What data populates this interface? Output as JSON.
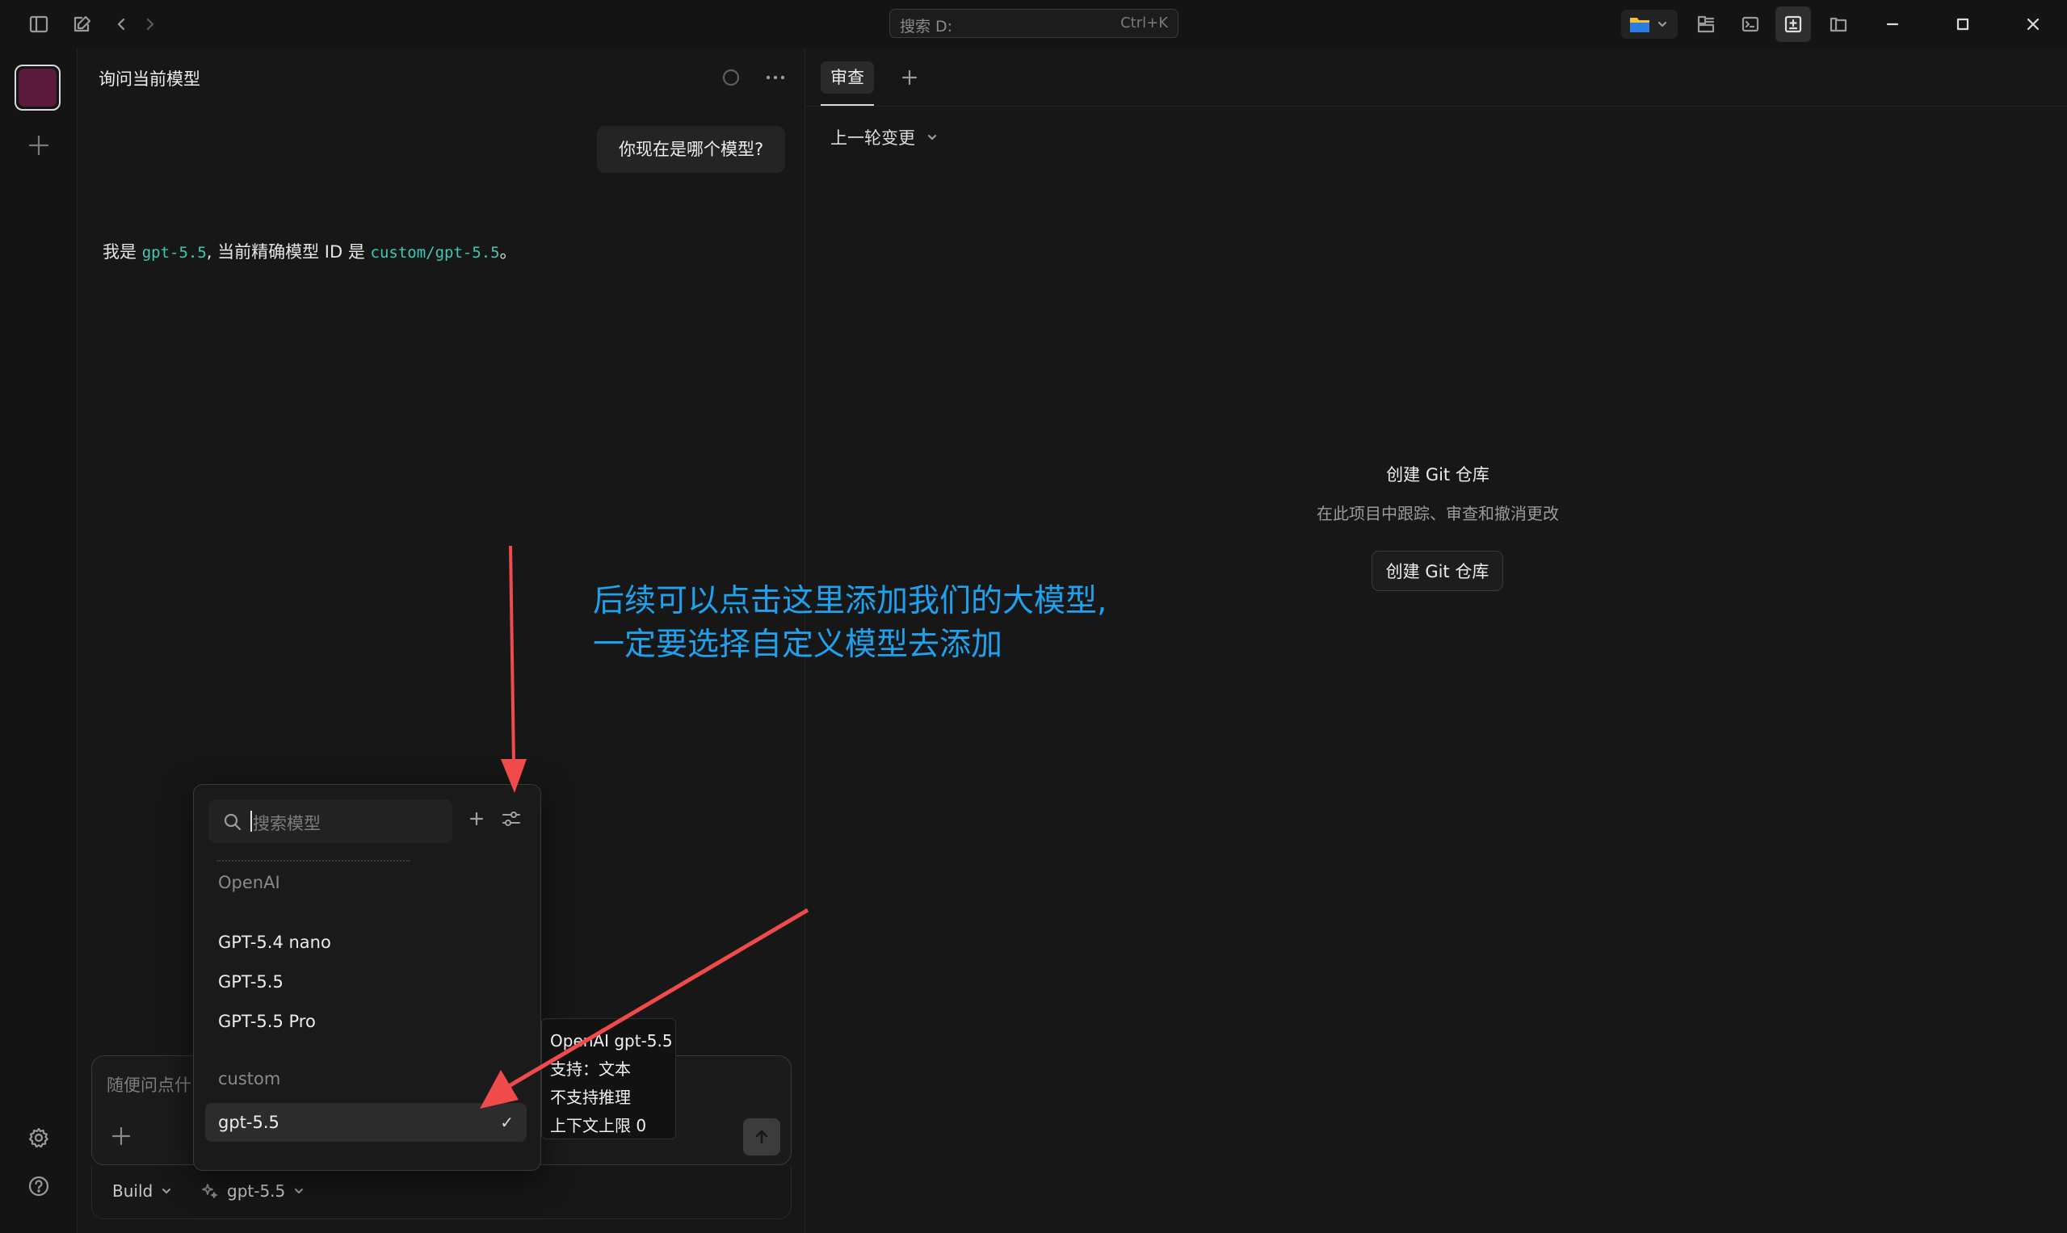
{
  "titlebar": {
    "search_placeholder": "搜索 D:",
    "search_shortcut": "Ctrl+K"
  },
  "chat": {
    "title": "询问当前模型",
    "user_message": "你现在是哪个模型?",
    "assistant": {
      "prefix": "我是 ",
      "model": "gpt-5.5",
      "middle": ", 当前精确模型 ID 是 ",
      "model_id": "custom/gpt-5.5",
      "suffix": "。"
    },
    "composer_placeholder": "随便问点什",
    "mode_label": "Build",
    "current_model": "gpt-5.5"
  },
  "model_dropdown": {
    "search_placeholder": "搜索模型",
    "groups": [
      {
        "label": "OpenAI",
        "items": [
          "GPT-5.4 nano",
          "GPT-5.5",
          "GPT-5.5 Pro"
        ]
      },
      {
        "label": "custom",
        "items": [
          "gpt-5.5"
        ]
      }
    ],
    "selected_check": "✓"
  },
  "tooltip": {
    "lines": [
      "OpenAI gpt-5.5",
      "支持：文本",
      "不支持推理",
      "上下文上限 0"
    ]
  },
  "review": {
    "tab_label": "审查",
    "prev_change_label": "上一轮变更",
    "git_title": "创建 Git 仓库",
    "git_description": "在此项目中跟踪、审查和撤消更改",
    "git_button": "创建 Git 仓库"
  },
  "annotation": {
    "line1": "后续可以点击这里添加我们的大模型,",
    "line2": "一定要选择自定义模型去添加",
    "color": "#1ea1ee",
    "arrow_color": "#f04a4a"
  },
  "colors": {
    "background": "#161616",
    "accent_code": "#3ecbb1",
    "avatar": "#5a1b3c"
  }
}
